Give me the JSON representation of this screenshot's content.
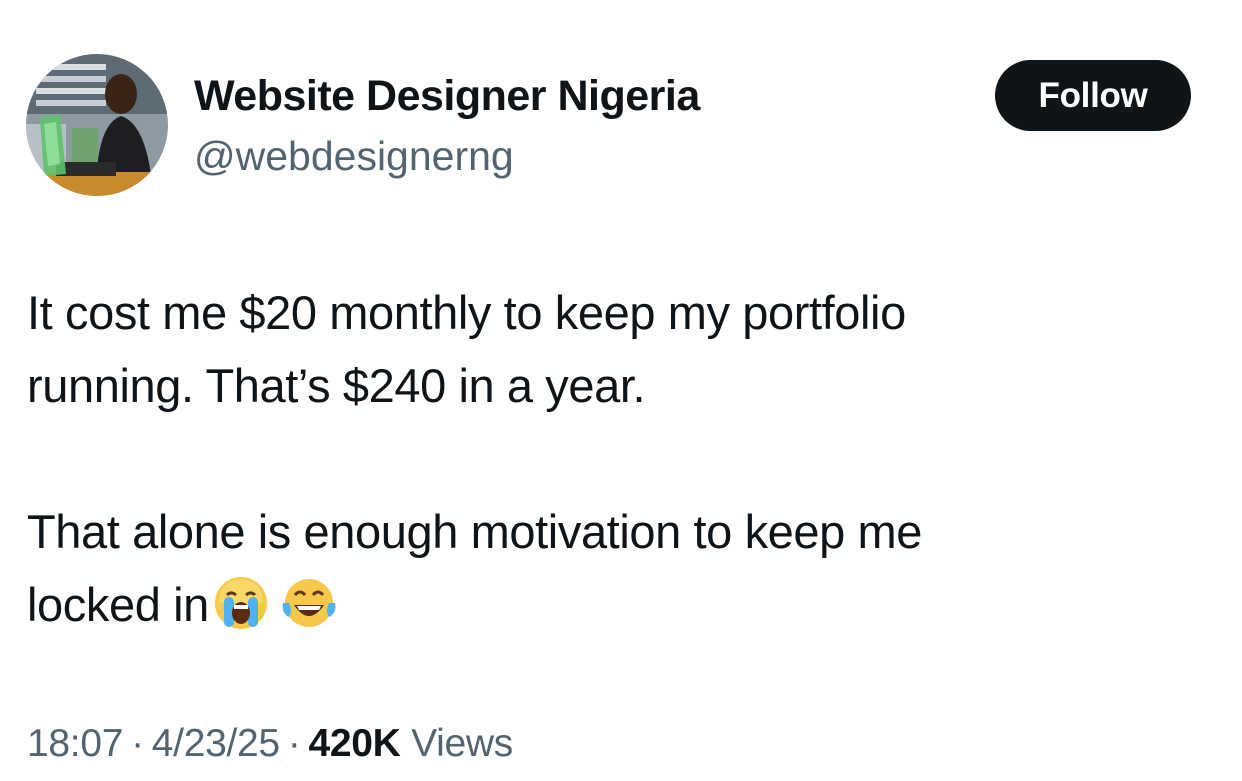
{
  "profile": {
    "display_name": "Website Designer Nigeria",
    "handle": "@webdesignerng",
    "avatar_icon": "profile-photo"
  },
  "actions": {
    "follow_label": "Follow"
  },
  "tweet": {
    "paragraph1_line1": "It cost me $20 monthly to keep my portfolio",
    "paragraph1_line2": "running. That’s $240 in a year.",
    "paragraph2_line1": "That alone is enough motivation to keep me",
    "paragraph2_line2": "locked in",
    "emojis": [
      "loudly-crying-face-emoji",
      "face-with-tears-of-joy-emoji"
    ]
  },
  "meta": {
    "time": "18:07",
    "separator": "·",
    "date": "4/23/25",
    "views_count": "420K",
    "views_label": "Views"
  },
  "colors": {
    "text": "#0f1419",
    "secondary": "#536471",
    "button_bg": "#0f1419",
    "button_text": "#ffffff"
  }
}
